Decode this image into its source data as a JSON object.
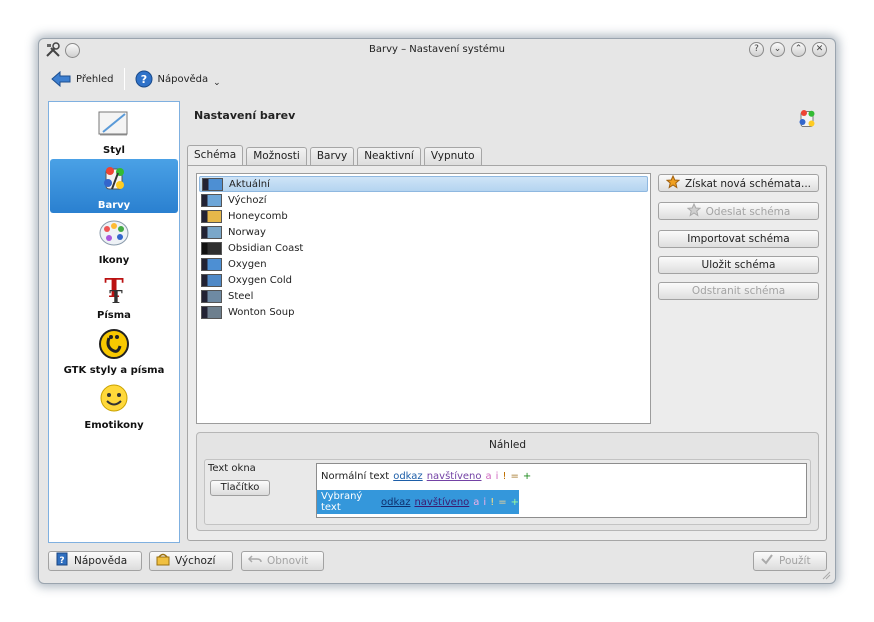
{
  "window": {
    "title": "Barvy – Nastavení systému"
  },
  "toolbar": {
    "overview_label": "Přehled",
    "help_label": "Nápověda"
  },
  "sidebar": {
    "items": [
      {
        "label": "Styl"
      },
      {
        "label": "Barvy"
      },
      {
        "label": "Ikony"
      },
      {
        "label": "Písma"
      },
      {
        "label": "GTK styly a písma"
      },
      {
        "label": "Emotikony"
      }
    ]
  },
  "content": {
    "title": "Nastavení barev"
  },
  "tabs": [
    {
      "label": "Schéma"
    },
    {
      "label": "Možnosti"
    },
    {
      "label": "Barvy"
    },
    {
      "label": "Neaktivní"
    },
    {
      "label": "Vypnuto"
    }
  ],
  "schemes": [
    {
      "name": "Aktuální",
      "swatch": "#4d8fd3"
    },
    {
      "name": "Výchozí",
      "swatch": "#6da6d8"
    },
    {
      "name": "Honeycomb",
      "swatch": "#e6b84a"
    },
    {
      "name": "Norway",
      "swatch": "#7aa7c9"
    },
    {
      "name": "Obsidian Coast",
      "swatch": "#2f2f2f"
    },
    {
      "name": "Oxygen",
      "swatch": "#4d8fd3"
    },
    {
      "name": "Oxygen Cold",
      "swatch": "#4f89c7"
    },
    {
      "name": "Steel",
      "swatch": "#6e8aa3"
    },
    {
      "name": "Wonton Soup",
      "swatch": "#6d7f8e"
    }
  ],
  "scheme_buttons": {
    "get_new": "Získat nová schémata...",
    "upload": "Odeslat schéma",
    "import": "Importovat schéma",
    "save": "Uložit schéma",
    "remove": "Odstranit schéma"
  },
  "preview": {
    "title": "Náhled",
    "window_text_label": "Text okna",
    "button_label": "Tlačítko",
    "normal_text": "Normální text",
    "selected_text": "Vybraný text",
    "link": "odkaz",
    "visited": "navštíveno",
    "a": "a",
    "i": "i",
    "excl": "!",
    "eq": "=",
    "plus": "+"
  },
  "bottom": {
    "help": "Nápověda",
    "defaults": "Výchozí",
    "reset": "Obnovit",
    "apply": "Použít"
  },
  "colors": {
    "accent": "#3497db",
    "sidebar_active": "#2a80d0"
  }
}
